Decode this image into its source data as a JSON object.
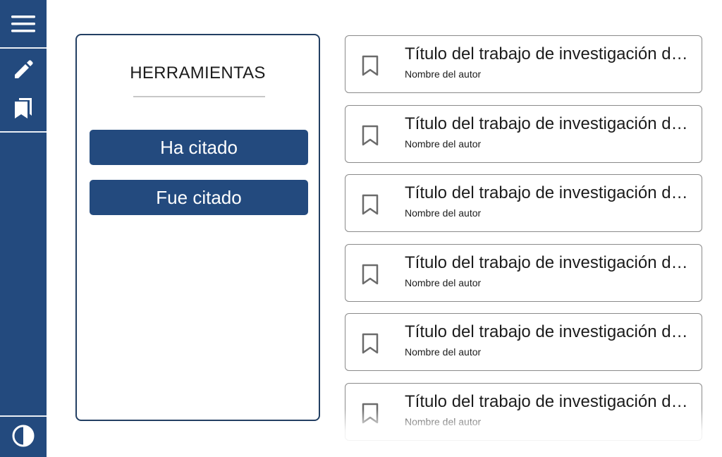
{
  "sidebar": {
    "menu_icon": "hamburger-menu-icon",
    "edit_icon": "pencil-icon",
    "bookmarks_icon": "bookmarks-icon",
    "contrast_icon": "contrast-icon"
  },
  "tools": {
    "title": "HERRAMIENTAS",
    "cited_label": "Ha citado",
    "cited_by_label": "Fue citado"
  },
  "results": [
    {
      "title": "Título del trabajo de investigación de ejemplo",
      "author": "Nombre del autor"
    },
    {
      "title": "Título del trabajo de investigación de ejemplo",
      "author": "Nombre del autor"
    },
    {
      "title": "Título del trabajo de investigación de ejemplo",
      "author": "Nombre del autor"
    },
    {
      "title": "Título del trabajo de investigación de ejemplo",
      "author": "Nombre del autor"
    },
    {
      "title": "Título del trabajo de investigación de ejemplo",
      "author": "Nombre del autor"
    },
    {
      "title": "Título del trabajo de investigación de ejemplo",
      "author": "Nombre del autor"
    }
  ],
  "colors": {
    "primary": "#234a7e",
    "panel_border": "#233f63",
    "card_border": "#8a8a8a"
  }
}
